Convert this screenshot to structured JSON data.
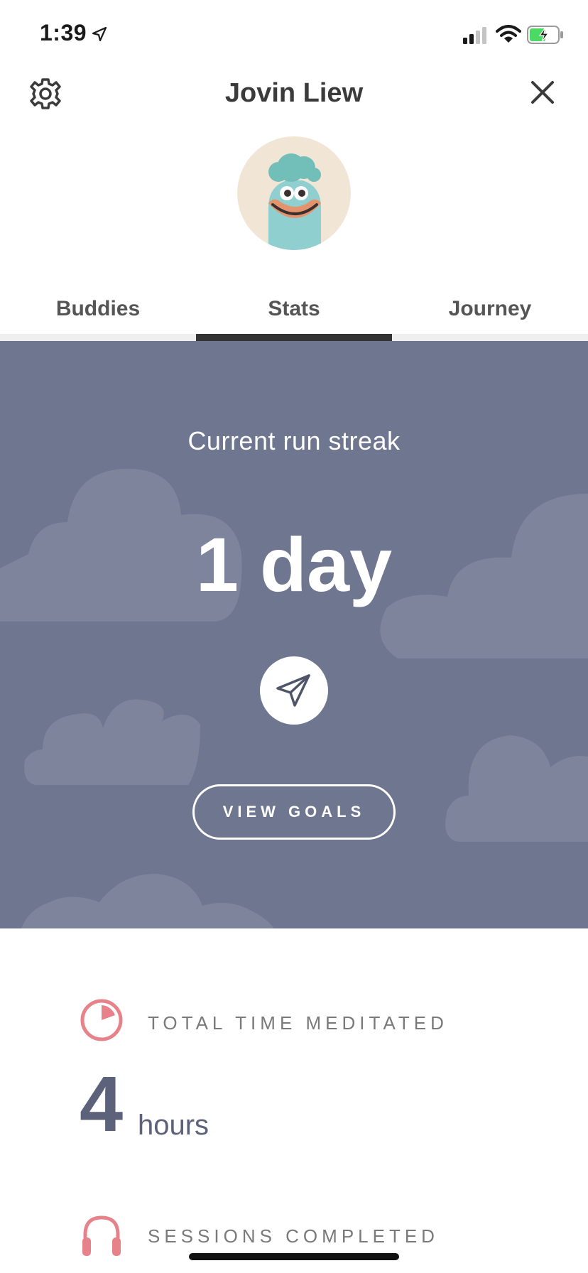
{
  "status_bar": {
    "time": "1:39",
    "icons": [
      "location-arrow-icon",
      "cellular-signal-icon",
      "wifi-icon",
      "battery-charging-icon"
    ]
  },
  "header": {
    "title": "Jovin Liew",
    "left_icon": "gear-icon",
    "right_icon": "close-icon"
  },
  "tabs": [
    {
      "label": "Buddies",
      "active": false
    },
    {
      "label": "Stats",
      "active": true
    },
    {
      "label": "Journey",
      "active": false
    }
  ],
  "streak": {
    "label": "Current run streak",
    "value": "1 day",
    "share_icon": "paper-plane-icon",
    "goals_button": "VIEW GOALS"
  },
  "stats": [
    {
      "label": "TOTAL TIME MEDITATED",
      "value": "4",
      "unit": "hours",
      "icon": "pie-clock-icon"
    },
    {
      "label": "SESSIONS COMPLETED",
      "icon": "headphones-icon"
    }
  ],
  "colors": {
    "streak_background": "#6f768f",
    "cloud": "#7e849b",
    "accent_pink": "#e8828a",
    "avatar_background": "#f1e6d6",
    "stat_number": "#5c627a"
  }
}
